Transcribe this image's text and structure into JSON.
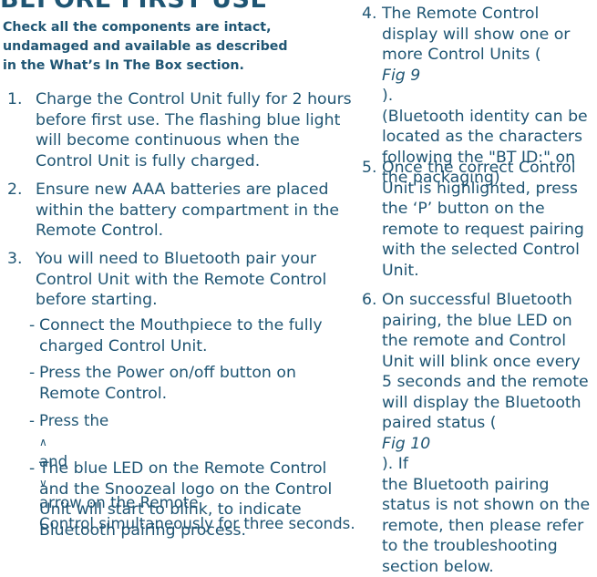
{
  "title": "BEFORE FIRST USE",
  "intro": [
    "Check all the components are intact,",
    "undamaged and available as described",
    "in the What’s In The Box section."
  ],
  "left_steps": [
    {
      "num": "1.",
      "lines": [
        "Charge the Control Unit fully for 2 hours",
        "before first use. The flashing blue light",
        "will become continuous when the",
        "Control Unit is fully charged."
      ]
    },
    {
      "num": "2.",
      "lines": [
        "Ensure new AAA batteries are placed",
        "within the battery compartment in the",
        "Remote Control."
      ]
    },
    {
      "num": "3.",
      "lines": [
        "You will need to Bluetooth pair your",
        "Control Unit with the Remote Control",
        "before starting."
      ]
    }
  ],
  "substeps": [
    {
      "lines": [
        "Connect the Mouthpiece to the fully",
        "charged Control Unit."
      ]
    },
    {
      "lines": [
        "Press the Power on/off button on",
        "Remote Control."
      ]
    },
    {
      "pre": "Press the ",
      "up": "∧",
      "mid": " and ",
      "down": "∨",
      "post": " arrow on the Remote",
      "line2": "Control simultaneously for three seconds."
    },
    {
      "lines": [
        "The blue LED on the Remote Control",
        "and the Snoozeal logo on the Control",
        "Unit will start to blink, to indicate",
        "Bluetooth pairing process."
      ]
    }
  ],
  "dash": "-",
  "right_steps": {
    "s4": {
      "num": "4.",
      "l1": "The Remote Control",
      "l2": "display will show one or",
      "l3a": "more Control Units (",
      "l3fig": "Fig 9",
      "l3b": ").",
      "l4": "(Bluetooth identity can be",
      "l5": "located as the characters",
      "l6": "following the \"BT ID:\" on",
      "l7": "the packaging)"
    },
    "s5": {
      "num": "5.",
      "lines": [
        "Once the correct Control",
        "Unit is highlighted, press",
        "the ‘P’ button on the",
        "remote to request pairing",
        "with  the selected Control",
        "Unit."
      ]
    },
    "s6": {
      "num": "6.",
      "l1": "On successful Bluetooth",
      "l2": "pairing, the blue LED on",
      "l3": "the remote and Control",
      "l4": "Unit will blink once every",
      "l5": "5 seconds and the remote",
      "l6": "will display the  Bluetooth",
      "l7a": "paired status (",
      "l7fig": "Fig 10",
      "l7b": "). If",
      "l8": "the Bluetooth pairing",
      "l9": "status is not shown on the",
      "l10": "remote, then  please refer",
      "l11": "to the troubleshooting",
      "l12": "section below."
    }
  }
}
